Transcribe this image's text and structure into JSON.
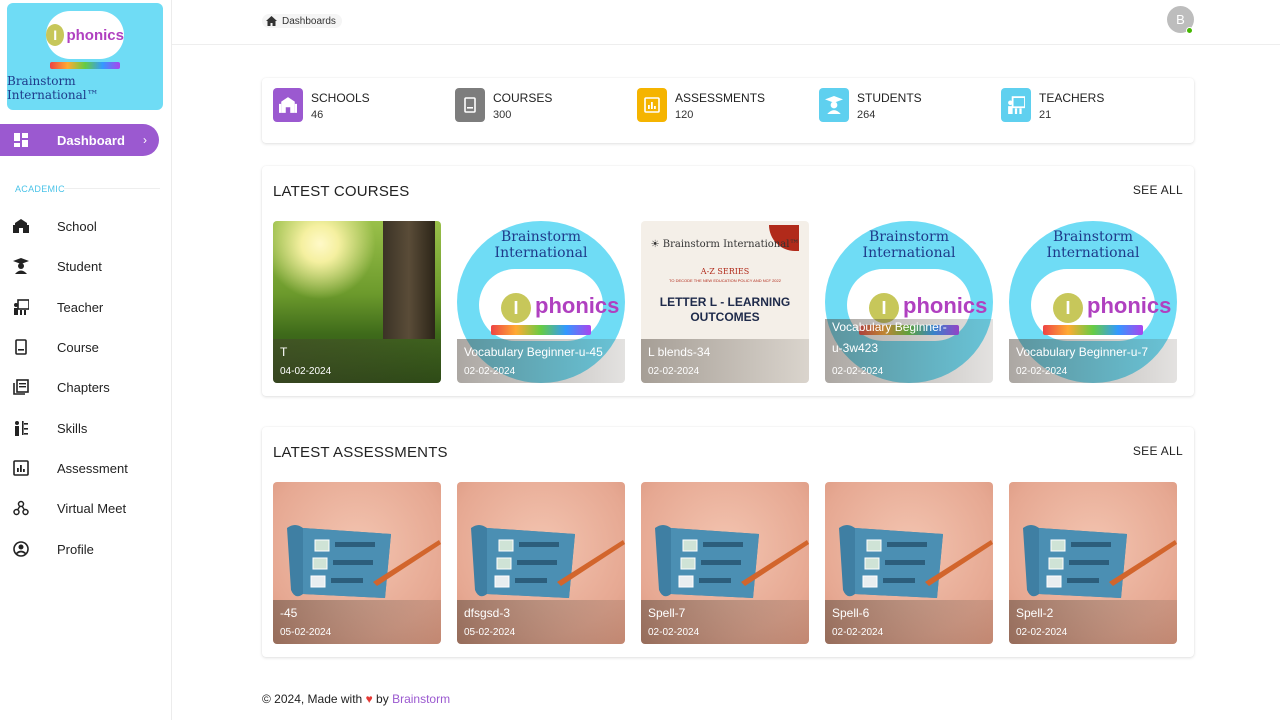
{
  "logo": {
    "word": "phonics",
    "letter": "I",
    "brand": "Brainstorm International™"
  },
  "sidebar": {
    "active": {
      "label": "Dashboard",
      "icon": "dashboard-icon"
    },
    "section_label": "ACADEMIC",
    "items": [
      {
        "label": "School",
        "icon": "school-icon"
      },
      {
        "label": "Student",
        "icon": "student-icon"
      },
      {
        "label": "Teacher",
        "icon": "teacher-icon"
      },
      {
        "label": "Course",
        "icon": "course-icon"
      },
      {
        "label": "Chapters",
        "icon": "chapters-icon"
      },
      {
        "label": "Skills",
        "icon": "skills-icon"
      },
      {
        "label": "Assessment",
        "icon": "assessment-icon"
      },
      {
        "label": "Virtual Meet",
        "icon": "virtual-meet-icon"
      },
      {
        "label": "Profile",
        "icon": "profile-icon"
      }
    ]
  },
  "header": {
    "breadcrumb": "Dashboards",
    "avatar_initial": "B"
  },
  "stats": [
    {
      "label": "SCHOOLS",
      "value": "46",
      "color": "#9b59d0",
      "icon": "school-icon"
    },
    {
      "label": "COURSES",
      "value": "300",
      "color": "#7d7d7d",
      "icon": "book-icon"
    },
    {
      "label": "ASSESSMENTS",
      "value": "120",
      "color": "#f5b400",
      "icon": "chart-icon"
    },
    {
      "label": "STUDENTS",
      "value": "264",
      "color": "#5fd0ef",
      "icon": "student-icon"
    },
    {
      "label": "TEACHERS",
      "value": "21",
      "color": "#5fd0ef",
      "icon": "teacher-icon"
    }
  ],
  "latest_courses": {
    "title": "LATEST COURSES",
    "see_all": "SEE ALL",
    "items": [
      {
        "name": "T",
        "date": "04-02-2024",
        "thumb": "forest"
      },
      {
        "name": "Vocabulary Beginner-u-45",
        "date": "02-02-2024",
        "thumb": "phonics"
      },
      {
        "name": "L blends-34",
        "date": "02-02-2024",
        "thumb": "letter"
      },
      {
        "name": "Vocabulary Beginner-u-3w423",
        "date": "02-02-2024",
        "thumb": "phonics"
      },
      {
        "name": "Vocabulary Beginner-u-7",
        "date": "02-02-2024",
        "thumb": "phonics"
      }
    ],
    "phonics_arc": "Brainstorm International",
    "letter_thumb": {
      "brand": "☀ Brainstorm International™",
      "series": "A-Z SERIES",
      "sub": "TO DECODE THE NEW EDUCATION POLICY AND NCF 2022",
      "heading": "LETTER L - LEARNING OUTCOMES"
    }
  },
  "latest_assessments": {
    "title": "LATEST ASSESSMENTS",
    "see_all": "SEE ALL",
    "items": [
      {
        "name": "-45",
        "date": "05-02-2024"
      },
      {
        "name": "dfsgsd-3",
        "date": "05-02-2024"
      },
      {
        "name": "Spell-7",
        "date": "02-02-2024"
      },
      {
        "name": "Spell-6",
        "date": "02-02-2024"
      },
      {
        "name": "Spell-2",
        "date": "02-02-2024"
      }
    ]
  },
  "footer": {
    "prefix": "© 2024, Made with",
    "heart": "♥",
    "by": "by",
    "brand": "Brainstorm"
  }
}
